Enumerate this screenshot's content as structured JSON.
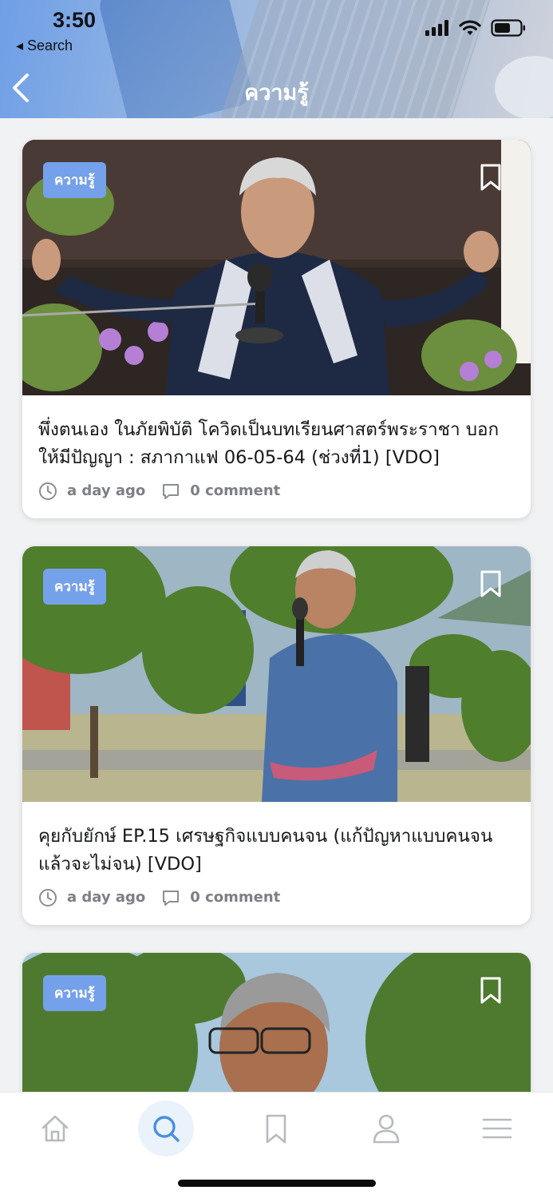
{
  "status_bar": {
    "time": "3:50",
    "back_label": "◂ Search"
  },
  "nav": {
    "title": "ความรู้"
  },
  "feed": [
    {
      "tag": "ความรู้",
      "title": "พึ่งตนเอง ในภัยพิบัติ โควิดเป็นบทเรียนศาสตร์พระราชา บอกให้มีปัญญา : สภากาแฟ 06-05-64 (ช่วงที่1) [VDO]",
      "time": "a day ago",
      "comments": "0 comment"
    },
    {
      "tag": "ความรู้",
      "title": "คุยกับยักษ์ EP.15 เศรษฐกิจแบบคนจน (แก้ปัญหาแบบคนจนแล้วจะไม่จน) [VDO]",
      "time": "a day ago",
      "comments": "0 comment"
    },
    {
      "tag": "ความรู้"
    }
  ],
  "tabbar": {
    "items": [
      "home-icon",
      "search-icon",
      "bookmark-icon",
      "profile-icon",
      "menu-icon"
    ],
    "active": "search-icon"
  },
  "colors": {
    "accent": "#75a1ea",
    "active_tab": "#4a8fe0",
    "inactive_tab": "#b7babf",
    "meta_text": "#7c7f85"
  }
}
